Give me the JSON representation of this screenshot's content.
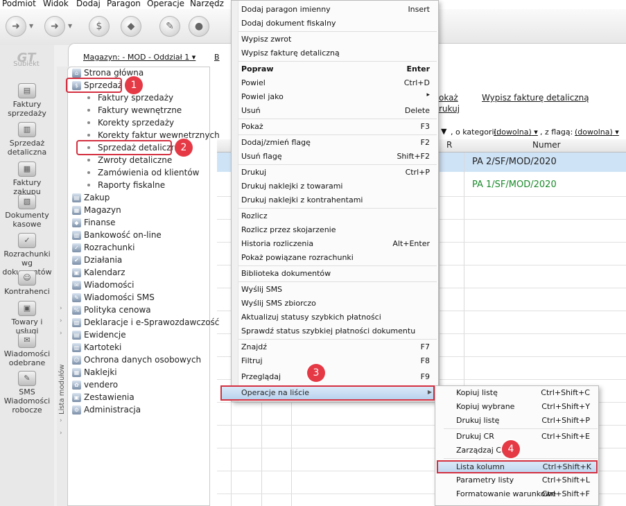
{
  "menubar": [
    "Podmiot",
    "Widok",
    "Dodaj",
    "Paragon",
    "Operacje",
    "Narzędz"
  ],
  "logo": {
    "mark": "GT",
    "name": "Subiekt"
  },
  "leftbar": [
    {
      "label": "Faktury sprzedaży",
      "icon": "invoices-icon"
    },
    {
      "label": "Sprzedaż detaliczna",
      "icon": "retail-sale-icon"
    },
    {
      "label": "Faktury zakupu",
      "icon": "purchase-invoices-icon"
    },
    {
      "label": "Dokumenty kasowe",
      "icon": "cash-documents-icon"
    },
    {
      "label": "Rozrachunki wg dokumentów",
      "icon": "settlements-icon"
    },
    {
      "label": "Kontrahenci",
      "icon": "contractors-icon"
    },
    {
      "label": "Towary i usługi",
      "icon": "goods-icon"
    },
    {
      "label": "Wiadomości odebrane",
      "icon": "messages-icon"
    },
    {
      "label": "SMS Wiadomości robocze",
      "icon": "sms-icon"
    }
  ],
  "topbar": {
    "warehouse": "Magazyn: - MOD - Oddział 1",
    "cut": "B"
  },
  "modules": {
    "side_label": "Lista modułów",
    "items": [
      {
        "label": "Strona główna",
        "icon": "home-icon"
      },
      {
        "label": "Sprzedaż",
        "icon": "sales-icon"
      },
      {
        "label": "Zakup",
        "icon": "purchase-icon"
      },
      {
        "label": "Magazyn",
        "icon": "warehouse-icon"
      },
      {
        "label": "Finanse",
        "icon": "finance-icon"
      },
      {
        "label": "Bankowość on-line",
        "icon": "bank-icon"
      },
      {
        "label": "Rozrachunki",
        "icon": "settlements-icon"
      },
      {
        "label": "Działania",
        "icon": "actions-icon"
      },
      {
        "label": "Kalendarz",
        "icon": "calendar-icon"
      },
      {
        "label": "Wiadomości",
        "icon": "messages-icon"
      },
      {
        "label": "Wiadomości SMS",
        "icon": "sms-icon"
      },
      {
        "label": "Polityka cenowa",
        "icon": "pricing-icon"
      },
      {
        "label": "Deklaracje i e-Sprawozdawczość",
        "icon": "declarations-icon"
      },
      {
        "label": "Ewidencje",
        "icon": "records-icon"
      },
      {
        "label": "Kartoteki",
        "icon": "files-icon"
      },
      {
        "label": "Ochrona danych osobowych",
        "icon": "privacy-icon"
      },
      {
        "label": "Naklejki",
        "icon": "labels-icon"
      },
      {
        "label": "vendero",
        "icon": "vendero-icon"
      },
      {
        "label": "Zestawienia",
        "icon": "reports-icon"
      },
      {
        "label": "Administracja",
        "icon": "admin-icon"
      }
    ],
    "sales_sub": [
      "Faktury sprzedaży",
      "Faktury wewnętrzne",
      "Korekty sprzedaży",
      "Korekty faktur wewnętrznych",
      "Sprzedaż detaliczna",
      "Zwroty detaliczne",
      "Zamówienia od klientów",
      "Raporty fiskalne"
    ]
  },
  "grid": {
    "links": [
      "okaż",
      "rukuj",
      "Wypisz fakturę detaliczną"
    ],
    "filter_kat_label": ", o kategorii:",
    "filter_kat_value": "(dowolna)",
    "filter_flag_label": ", z flagą:",
    "filter_flag_value": "(dowolna)",
    "col_r": "R",
    "col_numer": "Numer",
    "rows": [
      "PA 2/SF/MOD/2020",
      "PA 1/SF/MOD/2020"
    ],
    "row2_color": "#1a8a2a"
  },
  "context_menu": [
    {
      "label": "Dodaj paragon imienny",
      "shortcut": "Insert"
    },
    {
      "label": "Dodaj dokument fiskalny",
      "shortcut": ""
    },
    {
      "label": "Wypisz zwrot",
      "shortcut": ""
    },
    {
      "label": "Wypisz fakturę detaliczną",
      "shortcut": ""
    },
    {
      "label": "Popraw",
      "shortcut": "Enter"
    },
    {
      "label": "Powiel",
      "shortcut": "Ctrl+D"
    },
    {
      "label": "Powiel jako",
      "shortcut": "▸"
    },
    {
      "label": "Usuń",
      "shortcut": "Delete"
    },
    {
      "label": "Pokaż",
      "shortcut": "F3"
    },
    {
      "label": "Dodaj/zmień flagę",
      "shortcut": "F2"
    },
    {
      "label": "Usuń flagę",
      "shortcut": "Shift+F2"
    },
    {
      "label": "Drukuj",
      "shortcut": "Ctrl+P"
    },
    {
      "label": "Drukuj naklejki z towarami",
      "shortcut": ""
    },
    {
      "label": "Drukuj naklejki z kontrahentami",
      "shortcut": ""
    },
    {
      "label": "Rozlicz",
      "shortcut": ""
    },
    {
      "label": "Rozlicz przez skojarzenie",
      "shortcut": ""
    },
    {
      "label": "Historia rozliczenia",
      "shortcut": "Alt+Enter"
    },
    {
      "label": "Pokaż powiązane rozrachunki",
      "shortcut": ""
    },
    {
      "label": "Biblioteka dokumentów",
      "shortcut": ""
    },
    {
      "label": "Wyślij SMS",
      "shortcut": ""
    },
    {
      "label": "Wyślij SMS zbiorczo",
      "shortcut": ""
    },
    {
      "label": "Aktualizuj statusy szybkich płatności",
      "shortcut": ""
    },
    {
      "label": "Sprawdź status szybkiej płatności dokumentu",
      "shortcut": ""
    },
    {
      "label": "Znajdź",
      "shortcut": "F7"
    },
    {
      "label": "Filtruj",
      "shortcut": "F8"
    },
    {
      "label": "Przeglądaj",
      "shortcut": "F9"
    },
    {
      "label": "Operacje na liście",
      "shortcut": "▸"
    }
  ],
  "submenu": [
    {
      "label": "Kopiuj listę",
      "shortcut": "Ctrl+Shift+C"
    },
    {
      "label": "Kopiuj wybrane",
      "shortcut": "Ctrl+Shift+Y"
    },
    {
      "label": "Drukuj listę",
      "shortcut": "Ctrl+Shift+P"
    },
    {
      "label": "Drukuj CR",
      "shortcut": "Ctrl+Shift+E"
    },
    {
      "label": "Zarządzaj CR",
      "shortcut": ""
    },
    {
      "label": "Lista kolumn",
      "shortcut": "Ctrl+Shift+K"
    },
    {
      "label": "Parametry listy",
      "shortcut": "Ctrl+Shift+L"
    },
    {
      "label": "Formatowanie warunkowe",
      "shortcut": "Ctrl+Shift+F"
    }
  ],
  "badges": [
    "1",
    "2",
    "3",
    "4"
  ]
}
